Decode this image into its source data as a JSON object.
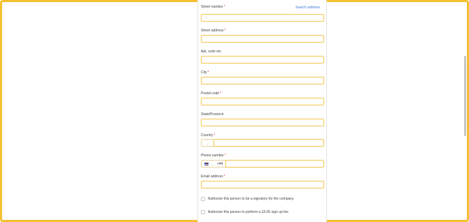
{
  "form": {
    "street_number": {
      "label": "Street number",
      "required_mark": "*",
      "value": ""
    },
    "search_address_link": "Search address",
    "street_address": {
      "label": "Street address",
      "required_mark": "*",
      "value": ""
    },
    "apt": {
      "label": "Apt, suite etc.",
      "value": ""
    },
    "city": {
      "label": "City",
      "required_mark": "*",
      "value": ""
    },
    "postal_code": {
      "label": "Postal code",
      "required_mark": "*",
      "value": ""
    },
    "state": {
      "label": "State/Province",
      "value": ""
    },
    "country": {
      "label": "Country",
      "required_mark": "*",
      "value": ""
    },
    "phone": {
      "label": "Phone number",
      "required_mark": "*",
      "dial_code": "+44",
      "flag": "uk-flag-icon",
      "value": ""
    },
    "email": {
      "label": "Email address",
      "required_mark": "*",
      "value": ""
    },
    "checkboxes": [
      {
        "label": "Authorize this person to be a signatory for the company",
        "checked": false
      },
      {
        "label": "Authorize this person to perform a £5.00 sign up fee",
        "checked": false
      }
    ]
  },
  "icons": {
    "street_number_prefix": "heart-icon",
    "stepper": "up-down-chevron-icon"
  },
  "colors": {
    "frame_border": "#f4c02e",
    "input_border": "#f3c64f",
    "link": "#3d7cd6",
    "required": "#d23b3b"
  }
}
